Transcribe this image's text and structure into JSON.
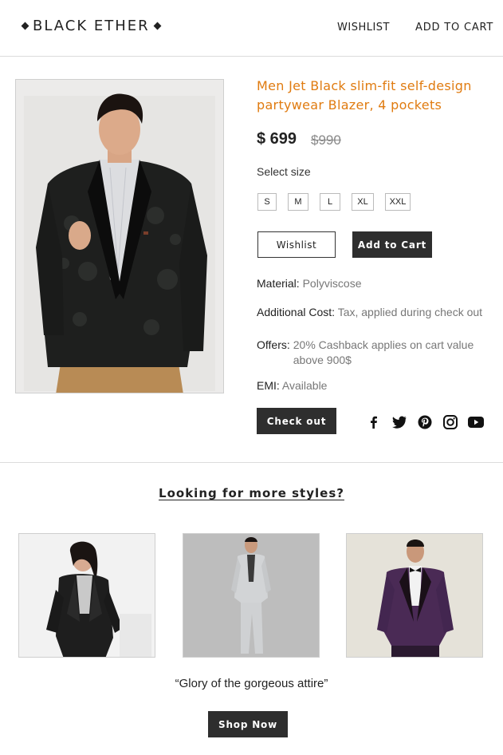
{
  "header": {
    "logo_text": "BLACK ETHER",
    "nav": {
      "wishlist": "WISHLIST",
      "add_to_cart": "ADD TO CART"
    }
  },
  "product": {
    "title": "Men Jet Black slim-fit self-design partywear Blazer, 4 pockets",
    "price": "$ 699",
    "old_price": "$990",
    "size_label": "Select size",
    "sizes": [
      "S",
      "M",
      "L",
      "XL",
      "XXL"
    ],
    "wishlist_button": "Wishlist",
    "add_to_cart_button": "Add to Cart",
    "material_label": "Material:",
    "material_value": "Polyviscose",
    "cost_label": "Additional Cost:",
    "cost_value": "Tax, applied during check out",
    "offers_label": "Offers:",
    "offers_value": "20% Cashback applies on cart value above 900$",
    "emi_label": "EMI:",
    "emi_value": "Available",
    "checkout_button": "Check out"
  },
  "socials": [
    "facebook-icon",
    "twitter-icon",
    "pinterest-icon",
    "instagram-icon",
    "youtube-icon"
  ],
  "more": {
    "title": "Looking for more styles?",
    "quote": "“Glory of the gorgeous attire”",
    "shop_button": "Shop Now"
  },
  "colors": {
    "accent": "#e07b10",
    "dark_button": "#2e2e2e",
    "muted_text": "#777777",
    "border": "#dcdcdc"
  }
}
